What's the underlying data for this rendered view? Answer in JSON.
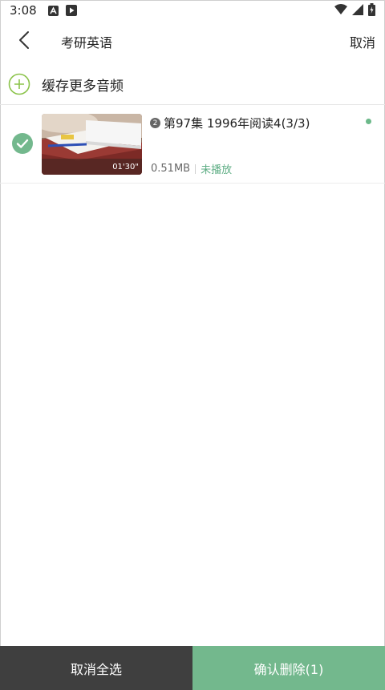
{
  "status_bar": {
    "time": "3:08",
    "left_icons": [
      "a-notification-icon",
      "play-store-icon"
    ],
    "right_icons": [
      "wifi-icon",
      "signal-icon",
      "battery-icon"
    ]
  },
  "header": {
    "title": "考研英语",
    "cancel_label": "取消"
  },
  "cache_more": {
    "label": "缓存更多音频",
    "icon": "plus-circle-icon",
    "accent": "#8bc34a"
  },
  "items": [
    {
      "title": "第97集 1996年阅读4(3/3)",
      "badge": "2",
      "duration": "01'30\"",
      "size": "0.51MB",
      "status": "未播放",
      "selected": true
    }
  ],
  "bottom": {
    "deselect_all_label": "取消全选",
    "confirm_delete_label": "确认删除(1)"
  },
  "colors": {
    "accent_green": "#73b88d",
    "dark_bar": "#3f3f3f",
    "status_green": "#5fae85"
  }
}
